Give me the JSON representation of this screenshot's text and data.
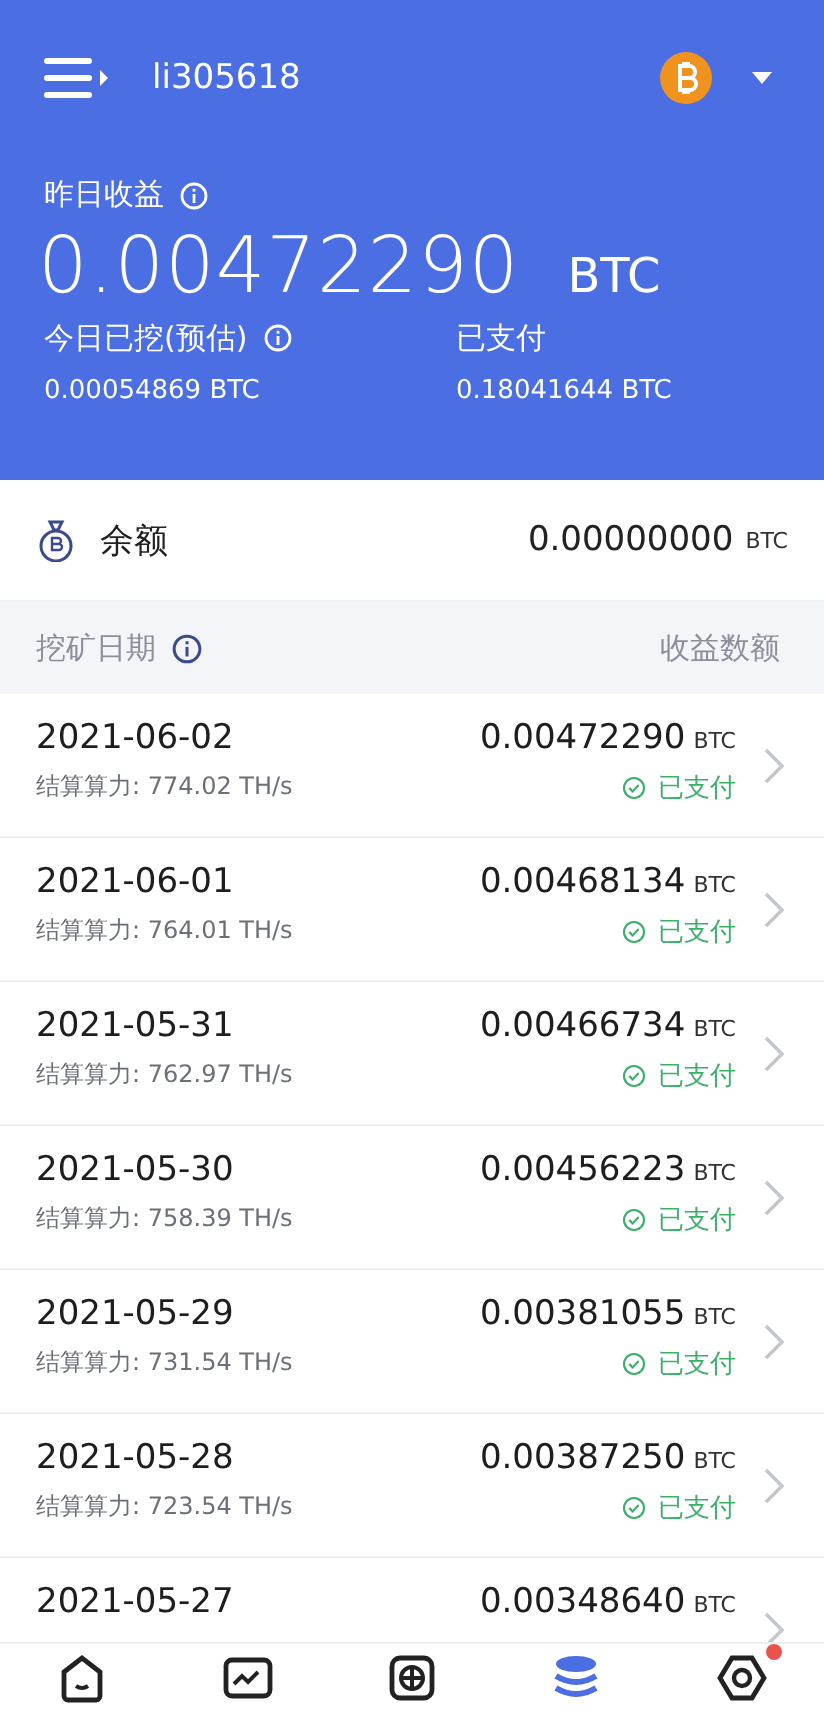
{
  "header": {
    "username": "li305618",
    "yesterday_label": "昨日收益",
    "yesterday_value": "0.00472290",
    "yesterday_unit": "BTC",
    "today_label": "今日已挖(预估)",
    "today_value": "0.00054869 BTC",
    "paid_label": "已支付",
    "paid_value": "0.18041644 BTC"
  },
  "balance": {
    "label": "余额",
    "value": "0.00000000",
    "unit": "BTC"
  },
  "table": {
    "columns": [
      "挖矿日期",
      "收益数额"
    ],
    "rows": [
      {
        "date": "2021-06-02",
        "hashrate": "结算算力: 774.02 TH/s",
        "amount": "0.00472290",
        "unit": "BTC",
        "status": "已支付"
      },
      {
        "date": "2021-06-01",
        "hashrate": "结算算力: 764.01 TH/s",
        "amount": "0.00468134",
        "unit": "BTC",
        "status": "已支付"
      },
      {
        "date": "2021-05-31",
        "hashrate": "结算算力: 762.97 TH/s",
        "amount": "0.00466734",
        "unit": "BTC",
        "status": "已支付"
      },
      {
        "date": "2021-05-30",
        "hashrate": "结算算力: 758.39 TH/s",
        "amount": "0.00456223",
        "unit": "BTC",
        "status": "已支付"
      },
      {
        "date": "2021-05-29",
        "hashrate": "结算算力: 731.54 TH/s",
        "amount": "0.00381055",
        "unit": "BTC",
        "status": "已支付"
      },
      {
        "date": "2021-05-28",
        "hashrate": "结算算力: 723.54 TH/s",
        "amount": "0.00387250",
        "unit": "BTC",
        "status": "已支付"
      },
      {
        "date": "2021-05-27",
        "amount": "0.00348640",
        "unit": "BTC"
      }
    ]
  },
  "nav": [
    {
      "kind": "home",
      "selected": false,
      "dot": false
    },
    {
      "kind": "chart",
      "selected": false,
      "dot": false
    },
    {
      "kind": "add",
      "selected": false,
      "dot": false
    },
    {
      "kind": "coins",
      "selected": true,
      "dot": false
    },
    {
      "kind": "settings",
      "selected": false,
      "dot": true
    }
  ]
}
